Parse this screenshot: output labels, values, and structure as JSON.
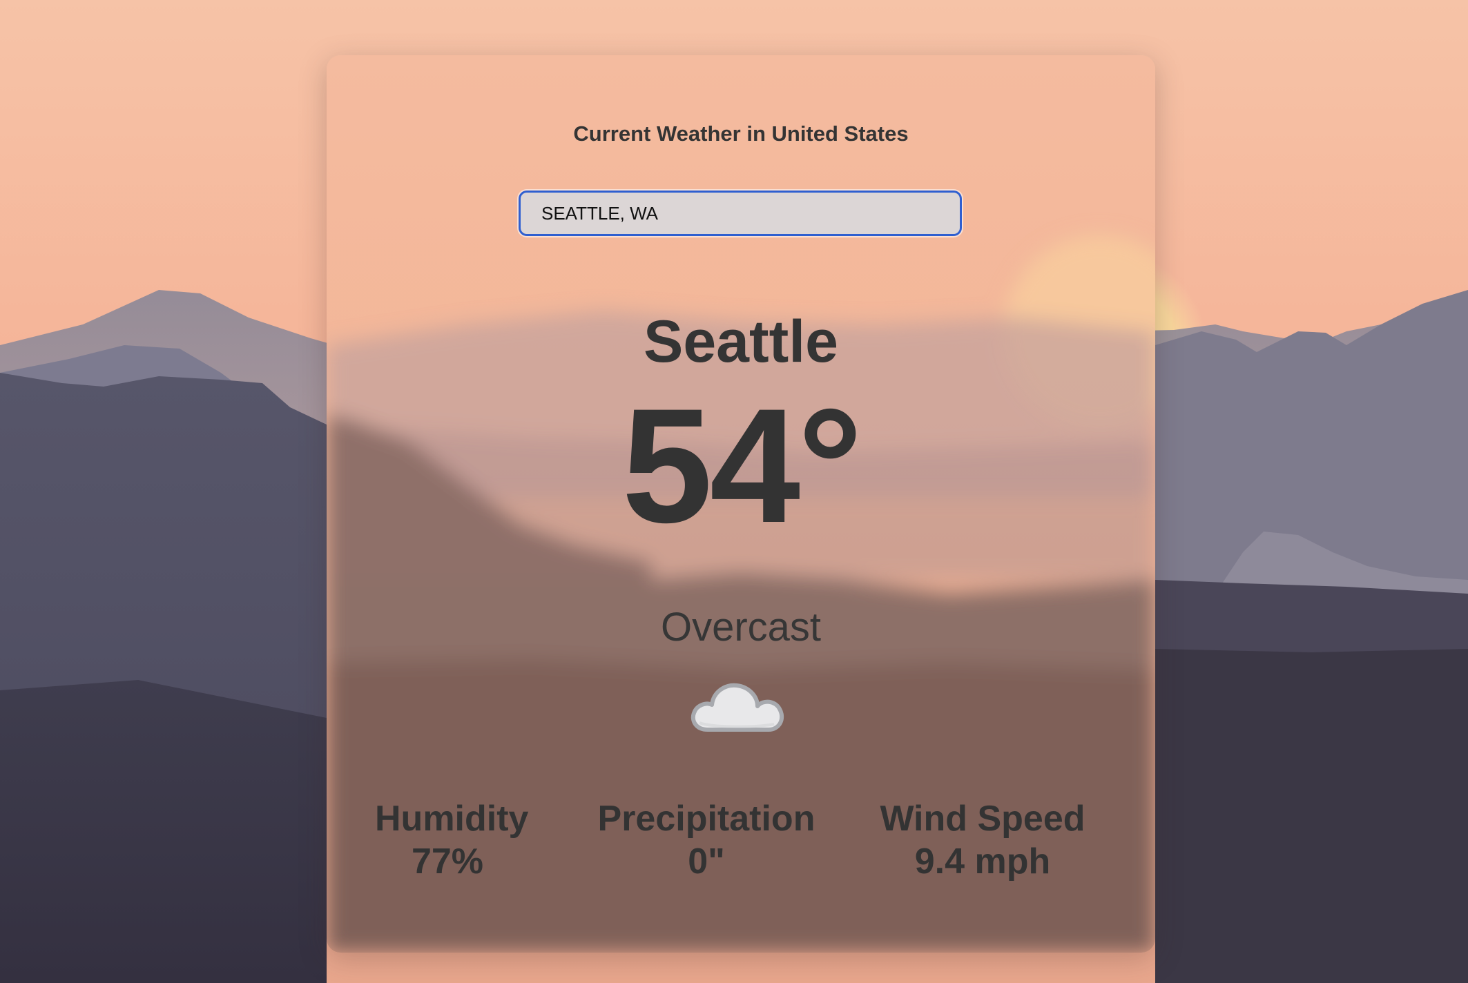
{
  "header": {
    "title": "Current Weather in United States"
  },
  "search": {
    "value": "SEATTLE, WA"
  },
  "weather": {
    "city": "Seattle",
    "temperature": "54°",
    "condition": "Overcast",
    "icon": "cloud-icon"
  },
  "stats": {
    "humidity": {
      "label": "Humidity",
      "value": "77%"
    },
    "precipitation": {
      "label": "Precipitation",
      "value": "0\""
    },
    "wind_speed": {
      "label": "Wind Speed",
      "value": "9.4 mph"
    }
  },
  "colors": {
    "sky_top": "#f6c2a6",
    "accent_border": "#2f5fd0",
    "text": "#333333"
  }
}
